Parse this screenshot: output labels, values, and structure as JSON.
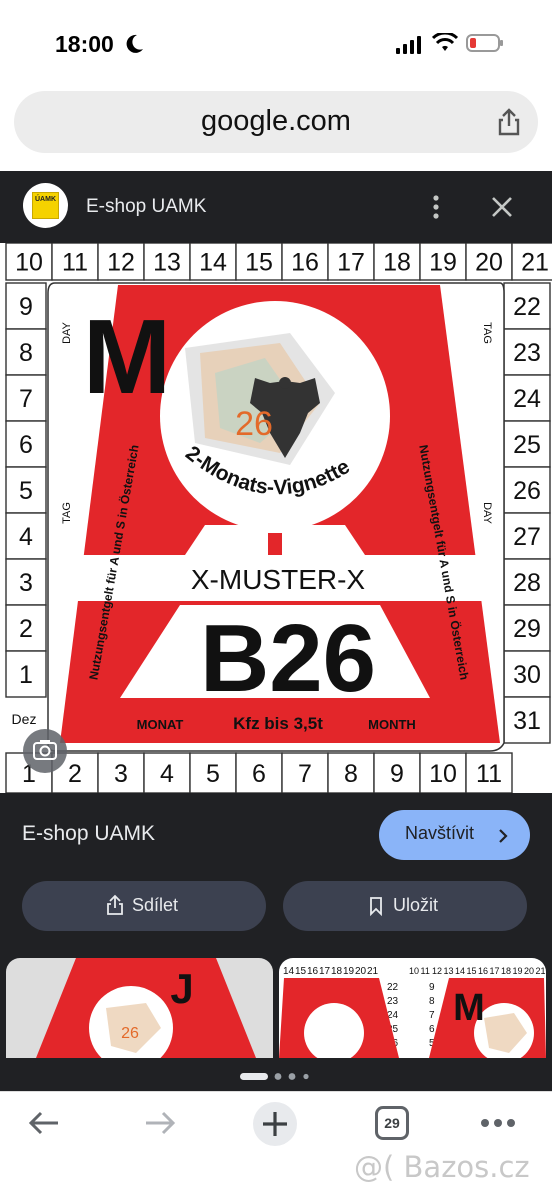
{
  "status": {
    "time": "18:00"
  },
  "browser": {
    "url": "google.com",
    "tab_count": "29"
  },
  "panel": {
    "site_title": "E-shop UAMK",
    "logo_text": "ÚAMK"
  },
  "vignette": {
    "top_numbers": [
      "10",
      "11",
      "12",
      "13",
      "14",
      "15",
      "16",
      "17",
      "18",
      "19",
      "20",
      "21"
    ],
    "left_numbers": [
      "9",
      "8",
      "7",
      "6",
      "5",
      "4",
      "3",
      "2",
      "1"
    ],
    "right_numbers": [
      "22",
      "23",
      "24",
      "25",
      "26",
      "27",
      "28",
      "29",
      "30",
      "31"
    ],
    "bottom_numbers": [
      "1",
      "2",
      "3",
      "4",
      "5",
      "6",
      "7",
      "8",
      "9",
      "10",
      "11"
    ],
    "month_letter": "M",
    "year": "26",
    "arc_text": "2-Monats-Vignette",
    "serial": "X-MUSTER-X",
    "code": "B26",
    "monat": "MONAT",
    "kfz": "Kfz bis 3,5t",
    "month": "MONTH",
    "day": "DAY",
    "tag": "TAG",
    "dez": "Dez",
    "side_text": "Nutzungsentgelt für A und S in Österreich"
  },
  "result": {
    "site_name": "E-shop UAMK",
    "visit_label": "Navštívit",
    "share_label": "Sdílet",
    "save_label": "Uložit"
  },
  "thumbs": {
    "t1_letter": "J",
    "t2_letter": "M"
  },
  "watermark": "@( Bazos.cz",
  "colors": {
    "vignette_red": "#e3262a",
    "accent_blue": "#8ab4f8",
    "panel_bg": "#202124"
  }
}
